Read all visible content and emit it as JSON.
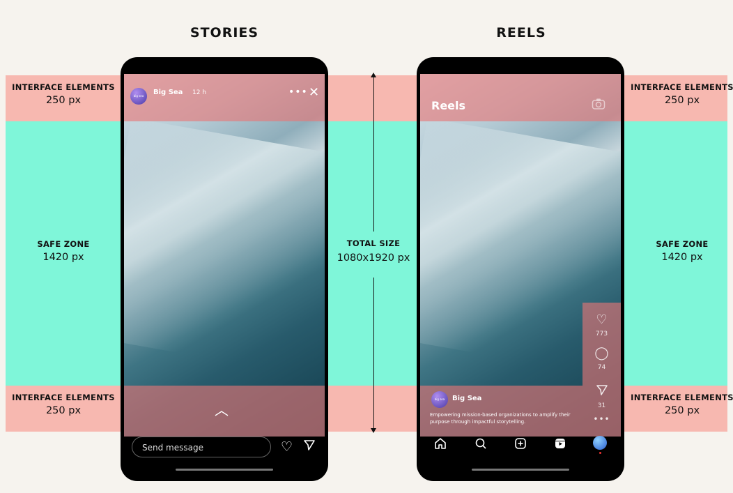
{
  "left_column": {
    "heading": "STORIES",
    "top_label": {
      "title": "INTERFACE ELEMENTS",
      "value": "250 px"
    },
    "safe_label": {
      "title": "SAFE ZONE",
      "value": "1420 px"
    },
    "bottom_label": {
      "title": "INTERFACE ELEMENTS",
      "value": "250 px"
    },
    "phone": {
      "username": "Big Sea",
      "time": "12 h",
      "avatar_text": "big sea",
      "more_icon": "more-dots-icon",
      "close_icon": "close-icon",
      "swipe_icon": "chevron-up-icon",
      "message_placeholder": "Send message",
      "heart_icon": "heart-icon",
      "send_icon": "send-icon"
    }
  },
  "center": {
    "title": "TOTAL SIZE",
    "value": "1080x1920 px"
  },
  "right_column": {
    "heading": "REELS",
    "top_label": {
      "title": "INTERFACE ELEMENTS",
      "value": "250 px"
    },
    "safe_label": {
      "title": "SAFE ZONE",
      "value": "1420 px"
    },
    "bottom_label": {
      "title": "INTERFACE ELEMENTS",
      "value": "250 px"
    },
    "phone": {
      "header": "Reels",
      "camera_icon": "camera-icon",
      "likes": "773",
      "comments": "74",
      "shares": "31",
      "username": "Big Sea",
      "avatar_text": "big sea",
      "caption": "Empowering mission-based organizations to amplify their purpose through impactful storytelling.",
      "nav_icons": [
        "home-icon",
        "search-icon",
        "add-icon",
        "reels-icon",
        "profile-icon"
      ]
    }
  },
  "colors": {
    "background": "#f6f3ee",
    "interface_band": "#f7b8b0",
    "safe_band": "#7ff6d9",
    "overlay": "#e97676"
  }
}
